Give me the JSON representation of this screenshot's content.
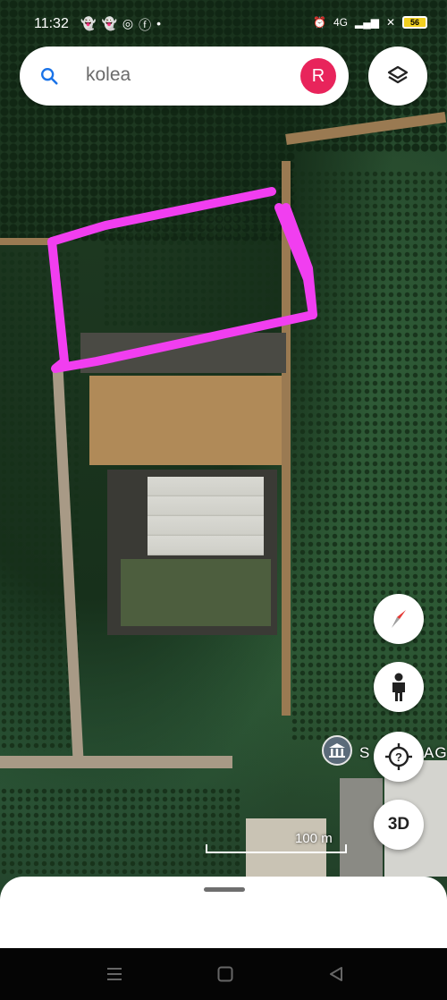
{
  "status_bar": {
    "time": "11:32",
    "battery": "56",
    "network": "4G"
  },
  "search": {
    "query": "kolea"
  },
  "account": {
    "initial": "R",
    "color": "#e8245b"
  },
  "map": {
    "place_label": "S",
    "place_label_suffix": "AG",
    "scale_label": "100 m",
    "highlight_color": "#f13ef0"
  },
  "buttons": {
    "three_d_label": "3D"
  },
  "icons": [
    "search-icon",
    "layers-icon",
    "compass-icon",
    "pegman-icon",
    "help-location-icon",
    "museum-icon"
  ]
}
